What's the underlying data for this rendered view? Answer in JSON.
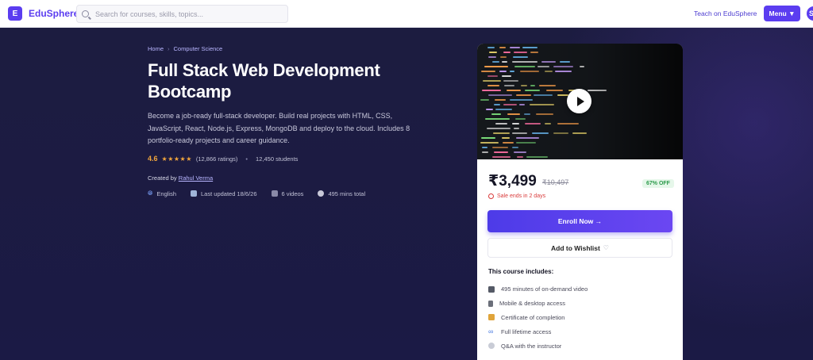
{
  "header": {
    "logo_letter": "E",
    "logo_text": "EduSphere",
    "search_placeholder": "Search for courses, skills, topics...",
    "teach_label": "Teach on EduSphere",
    "menu_label": "Menu ▼",
    "avatar_letter": "S"
  },
  "breadcrumb": [
    "Home",
    "Computer Science"
  ],
  "course": {
    "title": "Full Stack Web Development Bootcamp",
    "description": "Become a job-ready full-stack developer. Build real projects with HTML, CSS, JavaScript, React, Node.js, Express, MongoDB and deploy to the cloud. Includes 8 portfolio-ready projects and career guidance.",
    "rating": "4.6",
    "stars": "★★★★★",
    "ratings_count": "(12,866 ratings)",
    "students": "12,450 students",
    "created_by_label": "Created by",
    "instructor": "Rahul Verma",
    "meta": {
      "language": "English",
      "updated": "Last updated 18/6/26",
      "videos": "6 videos",
      "duration": "495 mins total"
    }
  },
  "card": {
    "price": "₹3,499",
    "old_price": "₹10,497",
    "discount": "67% OFF",
    "sale_text": "Sale ends in 2 days",
    "enroll_label": "Enroll Now →",
    "wishlist_label": "Add to Wishlist",
    "includes_title": "This course includes:",
    "includes": [
      {
        "icon": "video-icon",
        "text": "495 minutes of on-demand video"
      },
      {
        "icon": "mobile-icon",
        "text": "Mobile & desktop access"
      },
      {
        "icon": "certificate-icon",
        "text": "Certificate of completion"
      },
      {
        "icon": "infinity-icon",
        "text": "Full lifetime access"
      },
      {
        "icon": "chat-icon",
        "text": "Q&A with the instructor"
      }
    ]
  },
  "colors": {
    "brand": "#5b3df0",
    "hero_bg": "#1a1a3e",
    "rating": "#f3a63c",
    "sale": "#d93a3a",
    "discount": "#2b9a4a"
  }
}
